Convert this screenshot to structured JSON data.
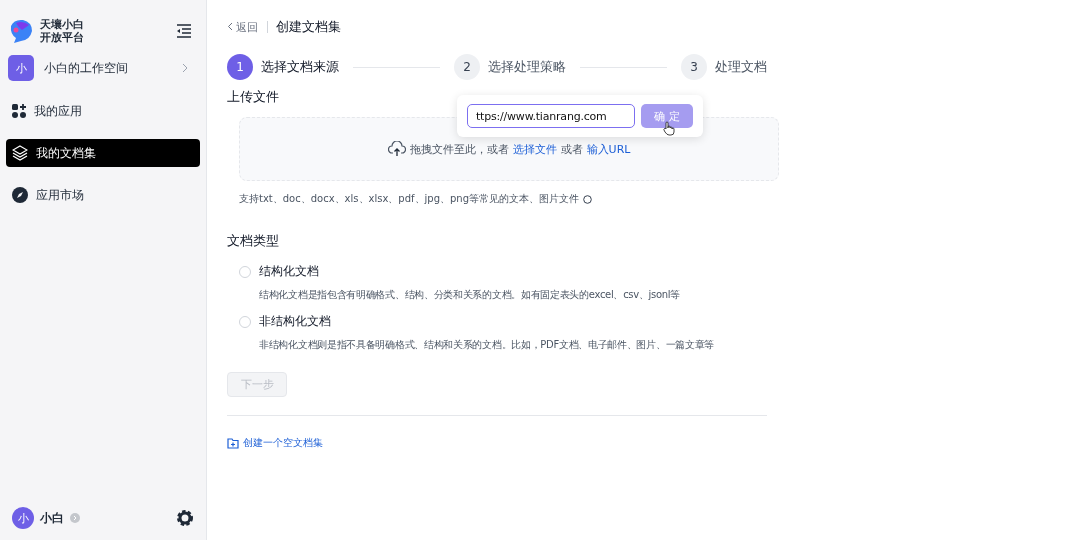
{
  "brand": {
    "line1": "天壤小白",
    "line2": "开放平台"
  },
  "workspace": {
    "avatar": "小",
    "name": "小白的工作空间"
  },
  "nav": [
    {
      "kind": "apps",
      "label": "我的应用",
      "selected": false
    },
    {
      "kind": "docs",
      "label": "我的文档集",
      "selected": true
    },
    {
      "kind": "market",
      "label": "应用市场",
      "selected": false
    }
  ],
  "user": {
    "avatar": "小",
    "name": "小白"
  },
  "header": {
    "back": "返回",
    "title": "创建文档集"
  },
  "steps": [
    {
      "number": "1",
      "label": "选择文档来源",
      "selected": true
    },
    {
      "number": "2",
      "label": "选择处理策略",
      "selected": false
    },
    {
      "number": "3",
      "label": "处理文档",
      "selected": false
    }
  ],
  "upload": {
    "title": "上传文件",
    "prompt": "拖拽文件至此，或者",
    "choose_link": "选择文件",
    "or": "或者",
    "url_link": "输入URL",
    "hint": "支持txt、doc、docx、xls、xlsx、pdf、jpg、png等常见的文本、图片文件"
  },
  "url_popover": {
    "value": "ttps://www.tianrang.com",
    "confirm": "确 定"
  },
  "doc_type": {
    "title": "文档类型",
    "options": [
      {
        "label": "结构化文档",
        "description": "结构化文档是指包含有明确格式、结构、分类和关系的文档。如有固定表头的excel、csv、jsonl等",
        "selected": false
      },
      {
        "label": "非结构化文档",
        "description": "非结构化文档则是指不具备明确格式、结构和关系的文档。比如，PDF文档、电子邮件、图片、一篇文章等",
        "selected": false
      }
    ]
  },
  "next_button": {
    "label": "下一步",
    "disabled": true
  },
  "create_empty": "创建一个空文档集"
}
